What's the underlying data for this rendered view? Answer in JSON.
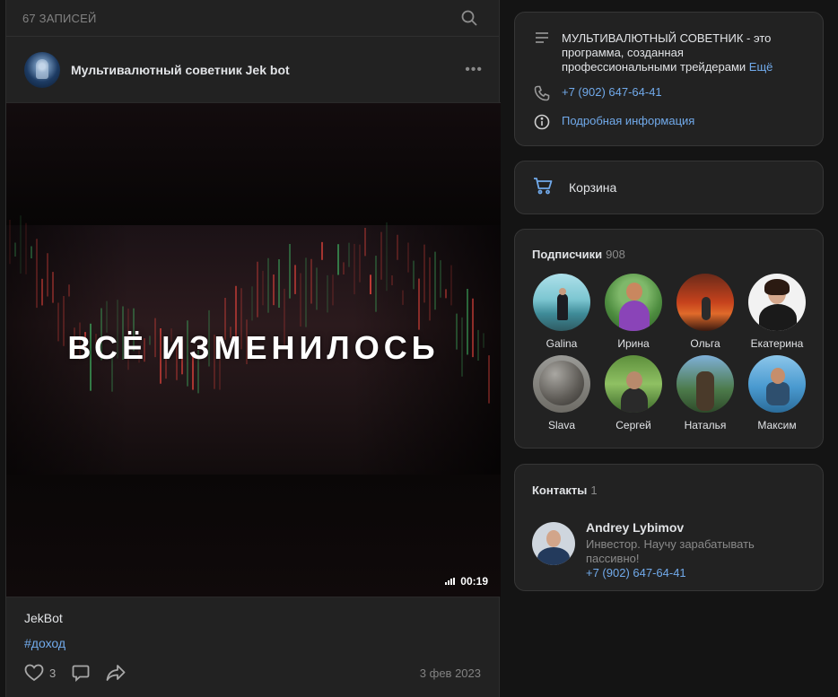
{
  "feed": {
    "count_label": "67 ЗАПИСЕЙ",
    "search_icon": "search-icon"
  },
  "post": {
    "author": "Мультивалютный советник Jek bot",
    "more_icon": "more-horizontal-icon",
    "more_label": "•••",
    "video": {
      "title": "ВСЁ ИЗМЕНИЛОСЬ",
      "duration": "00:19"
    },
    "text": "JekBot",
    "hashtag": "#доход",
    "likes": "3",
    "date": "3 фев 2023"
  },
  "info": {
    "description": "МУЛЬТИВАЛЮТНЫЙ СОВЕТНИК - это программа, созданная профессиональными трейдерами",
    "more_label": "Ещё",
    "phone": "+7 (902) 647-64-41",
    "details_label": "Подробная информация"
  },
  "cart": {
    "label": "Корзина"
  },
  "subscribers": {
    "title": "Подписчики",
    "count": "908",
    "items": [
      {
        "name": "Galina"
      },
      {
        "name": "Ирина"
      },
      {
        "name": "Ольга"
      },
      {
        "name": "Екатерина"
      },
      {
        "name": "Slava"
      },
      {
        "name": "Сергей"
      },
      {
        "name": "Наталья"
      },
      {
        "name": "Максим"
      }
    ]
  },
  "contacts": {
    "title": "Контакты",
    "count": "1",
    "person": {
      "name": "Andrey Lybimov",
      "role": "Инвестор. Научу зарабатывать пассивно!",
      "phone": "+7 (902) 647-64-41"
    }
  },
  "colors": {
    "background": "#141414",
    "panel": "#222222",
    "link": "#71aaeb",
    "text": "#e1e3e6",
    "muted": "#828282"
  }
}
